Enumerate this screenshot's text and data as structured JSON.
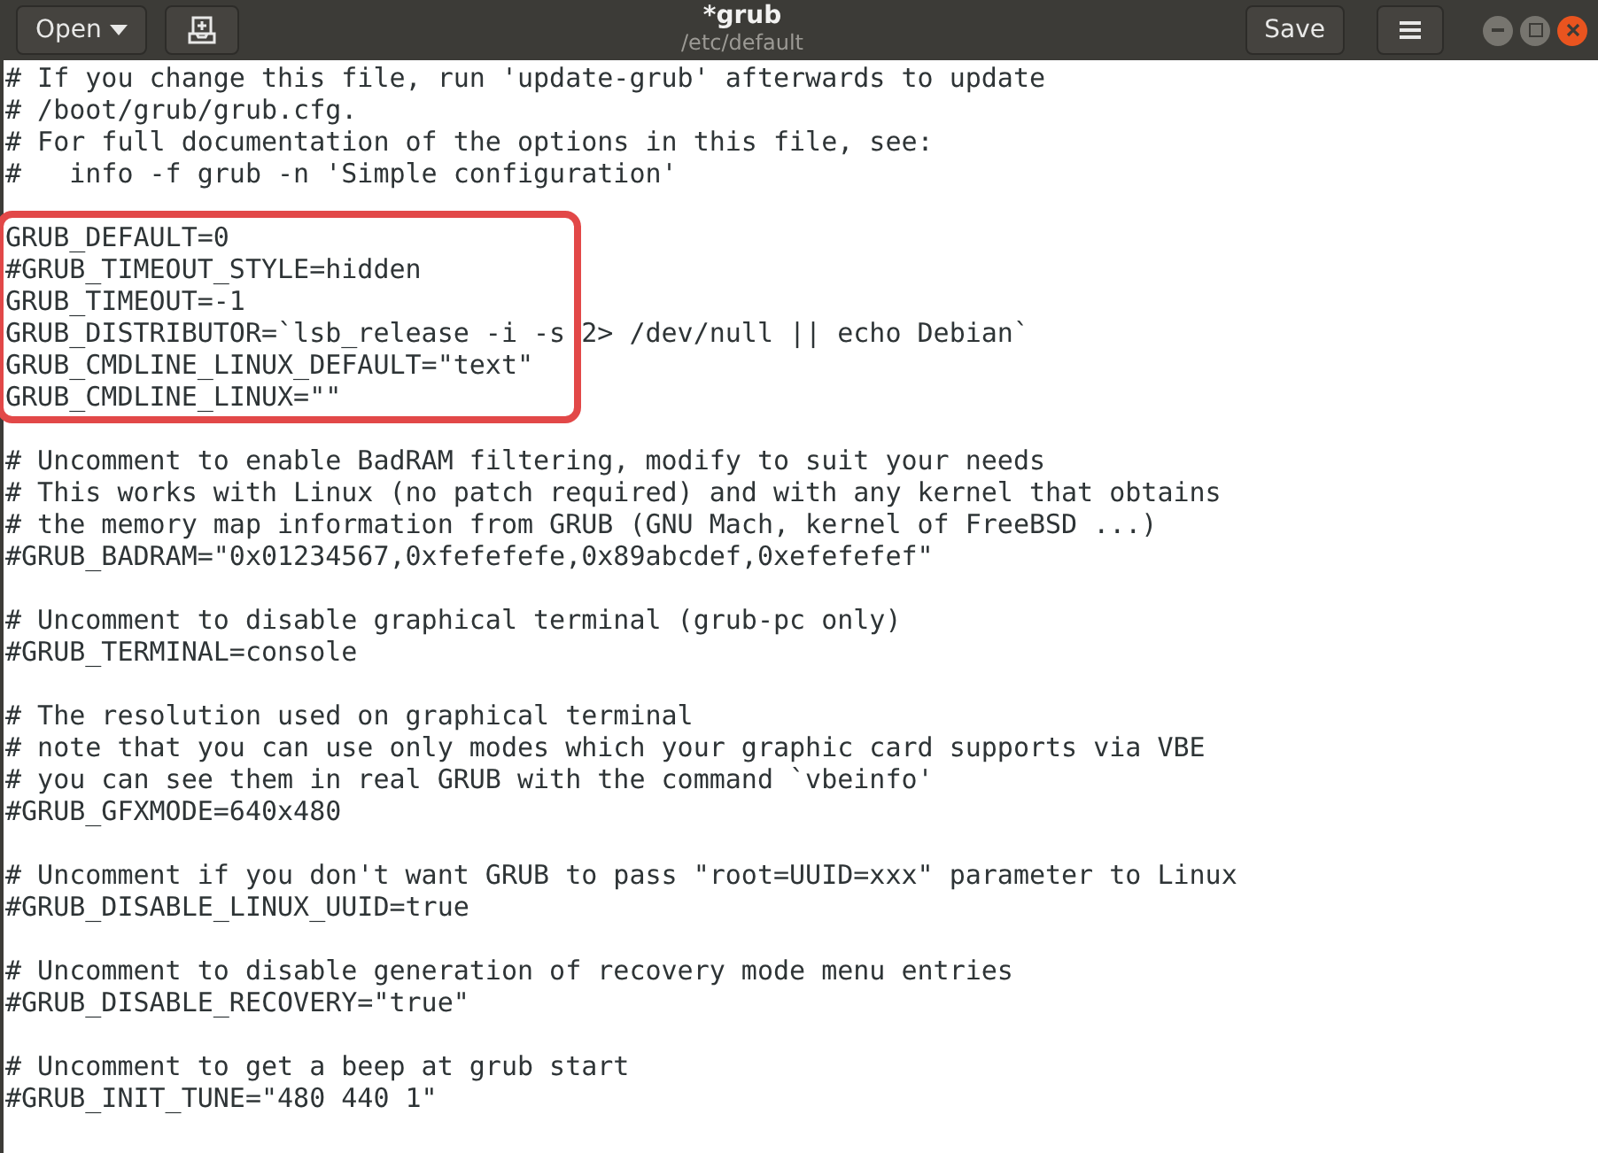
{
  "header": {
    "open_label": "Open",
    "title": "*grub",
    "subtitle": "/etc/default",
    "save_label": "Save"
  },
  "blocks": [
    {
      "highlighted": false,
      "lines": [
        "# If you change this file, run 'update-grub' afterwards to update",
        "# /boot/grub/grub.cfg.",
        "# For full documentation of the options in this file, see:",
        "#   info -f grub -n 'Simple configuration'"
      ]
    },
    {
      "highlighted": true,
      "lines": [
        "GRUB_DEFAULT=0",
        "#GRUB_TIMEOUT_STYLE=hidden",
        "GRUB_TIMEOUT=-1",
        "GRUB_DISTRIBUTOR=`lsb_release -i -s 2> /dev/null || echo Debian`",
        "GRUB_CMDLINE_LINUX_DEFAULT=\"text\"",
        "GRUB_CMDLINE_LINUX=\"\""
      ]
    },
    {
      "highlighted": false,
      "lines": [
        "# Uncomment to enable BadRAM filtering, modify to suit your needs",
        "# This works with Linux (no patch required) and with any kernel that obtains",
        "# the memory map information from GRUB (GNU Mach, kernel of FreeBSD ...)",
        "#GRUB_BADRAM=\"0x01234567,0xfefefefe,0x89abcdef,0xefefefef\""
      ]
    },
    {
      "highlighted": false,
      "lines": [
        "# Uncomment to disable graphical terminal (grub-pc only)",
        "#GRUB_TERMINAL=console"
      ]
    },
    {
      "highlighted": false,
      "lines": [
        "# The resolution used on graphical terminal",
        "# note that you can use only modes which your graphic card supports via VBE",
        "# you can see them in real GRUB with the command `vbeinfo'",
        "#GRUB_GFXMODE=640x480"
      ]
    },
    {
      "highlighted": false,
      "lines": [
        "# Uncomment if you don't want GRUB to pass \"root=UUID=xxx\" parameter to Linux",
        "#GRUB_DISABLE_LINUX_UUID=true"
      ]
    },
    {
      "highlighted": false,
      "lines": [
        "# Uncomment to disable generation of recovery mode menu entries",
        "#GRUB_DISABLE_RECOVERY=\"true\""
      ]
    },
    {
      "highlighted": false,
      "lines": [
        "# Uncomment to get a beep at grub start",
        "#GRUB_INIT_TUNE=\"480 440 1\""
      ]
    }
  ]
}
